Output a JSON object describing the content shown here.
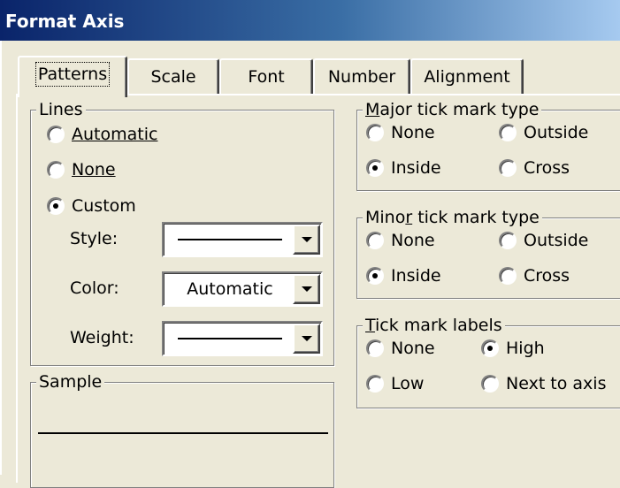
{
  "window": {
    "title": "Format Axis"
  },
  "tabs": [
    {
      "label": "Patterns",
      "active": true
    },
    {
      "label": "Scale"
    },
    {
      "label": "Font"
    },
    {
      "label": "Number"
    },
    {
      "label": "Alignment"
    }
  ],
  "lines": {
    "legend": "Lines",
    "options": [
      "Automatic",
      "None",
      "Custom"
    ],
    "selected": "Custom",
    "style_label": "Style:",
    "color_label": "Color:",
    "color_value": "Automatic",
    "weight_label": "Weight:"
  },
  "sample": {
    "legend": "Sample"
  },
  "major_tick": {
    "legend": "Major tick mark type",
    "options": [
      "None",
      "Outside",
      "Inside",
      "Cross"
    ],
    "selected": "Inside"
  },
  "minor_tick": {
    "legend": "Minor tick mark type",
    "options": [
      "None",
      "Outside",
      "Inside",
      "Cross"
    ],
    "selected": "Inside"
  },
  "tick_labels": {
    "legend": "Tick mark labels",
    "options": [
      "None",
      "High",
      "Low",
      "Next to axis"
    ],
    "selected": "High"
  },
  "colors": {
    "title_gradient_start": "#0a246a",
    "title_gradient_end": "#a6caf0",
    "dialog_face": "#ece9d8"
  }
}
